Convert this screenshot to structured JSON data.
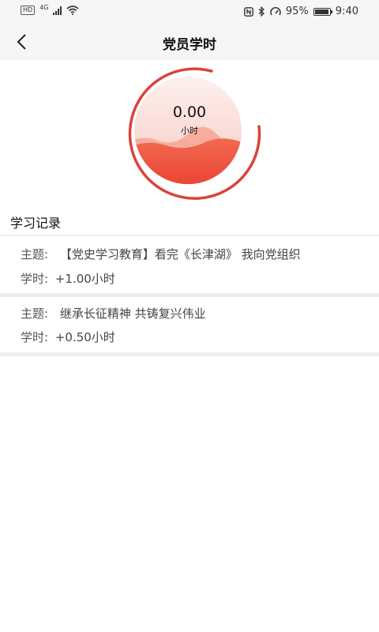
{
  "status_bar": {
    "hd": "HD",
    "network": "4G",
    "battery_percent": "95%",
    "battery_level": 0.95,
    "time": "9:40",
    "icons": [
      "hd-icon",
      "signal-icon",
      "wifi-icon",
      "nfc-icon",
      "bluetooth-icon",
      "data-saver-icon",
      "battery-icon"
    ]
  },
  "header": {
    "title": "党员学时",
    "back_icon": "chevron-left-icon"
  },
  "summary": {
    "hours_value": "0.00",
    "hours_unit": "小时",
    "accent_color": "#e0443a"
  },
  "records": {
    "title": "学习记录",
    "items": [
      {
        "topic_label": "主题:",
        "topic": "【党史学习教育】看完《长津湖》 我向党组织",
        "hours_label": "学时:",
        "hours": "+1.00小时"
      },
      {
        "topic_label": "主题:",
        "topic": "继承长征精神 共铸复兴伟业",
        "hours_label": "学时:",
        "hours": "+0.50小时"
      }
    ]
  }
}
